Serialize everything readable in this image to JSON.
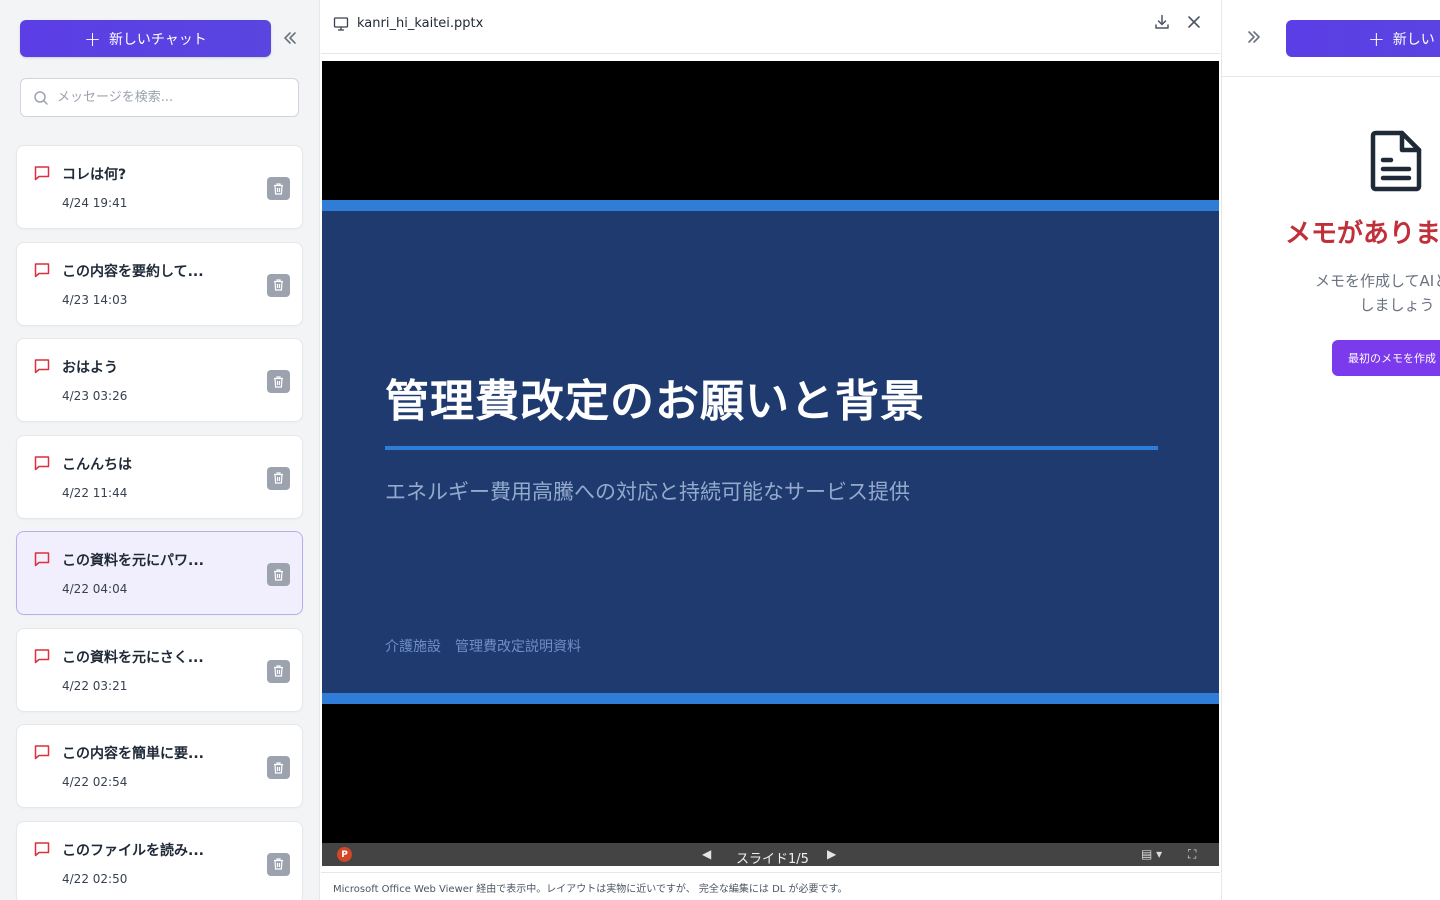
{
  "sidebar": {
    "new_chat_label": "新しいチャット",
    "collapse_icon": "double-chevron-left",
    "search_placeholder": "メッセージを検索...",
    "chats": [
      {
        "title": "コレは何?",
        "date": "4/24 19:41",
        "active": false
      },
      {
        "title": "この内容を要約して...",
        "date": "4/23 14:03",
        "active": false
      },
      {
        "title": "おはよう",
        "date": "4/23 03:26",
        "active": false
      },
      {
        "title": "こんんちは",
        "date": "4/22 11:44",
        "active": false
      },
      {
        "title": "この資料を元にパワ...",
        "date": "4/22 04:04",
        "active": true
      },
      {
        "title": "この資料を元にさく...",
        "date": "4/22 03:21",
        "active": false
      },
      {
        "title": "この内容を簡単に要...",
        "date": "4/22 02:54",
        "active": false
      },
      {
        "title": "このファイルを読み...",
        "date": "4/22 02:50",
        "active": false
      }
    ]
  },
  "viewer": {
    "file_name": "kanri_hi_kaitei.pptx",
    "slide": {
      "title": "管理費改定のお願いと背景",
      "subtitle": "エネルギー費用高騰への対応と持続可能なサービス提供",
      "footer": "介護施設　管理費改定説明資料"
    },
    "toolbar": {
      "counter": "スライド1/5"
    },
    "footer_note": "Microsoft Office Web Viewer 経由で表示中。レイアウトは実物に近いですが、 完全な編集には DL が必要です。"
  },
  "right_panel": {
    "new_label": "新しい",
    "empty_title": "メモがありま",
    "empty_desc_line1": "メモを作成してAIとの会",
    "empty_desc_line2": "しましょう",
    "create_button": "最初のメモを作成"
  },
  "colors": {
    "accent": "#5b3ee6",
    "slide_bg": "#1e3a6e",
    "slide_accent": "#2f7dd6",
    "memo_title": "#c0303a",
    "memo_button": "#7c3aed"
  }
}
